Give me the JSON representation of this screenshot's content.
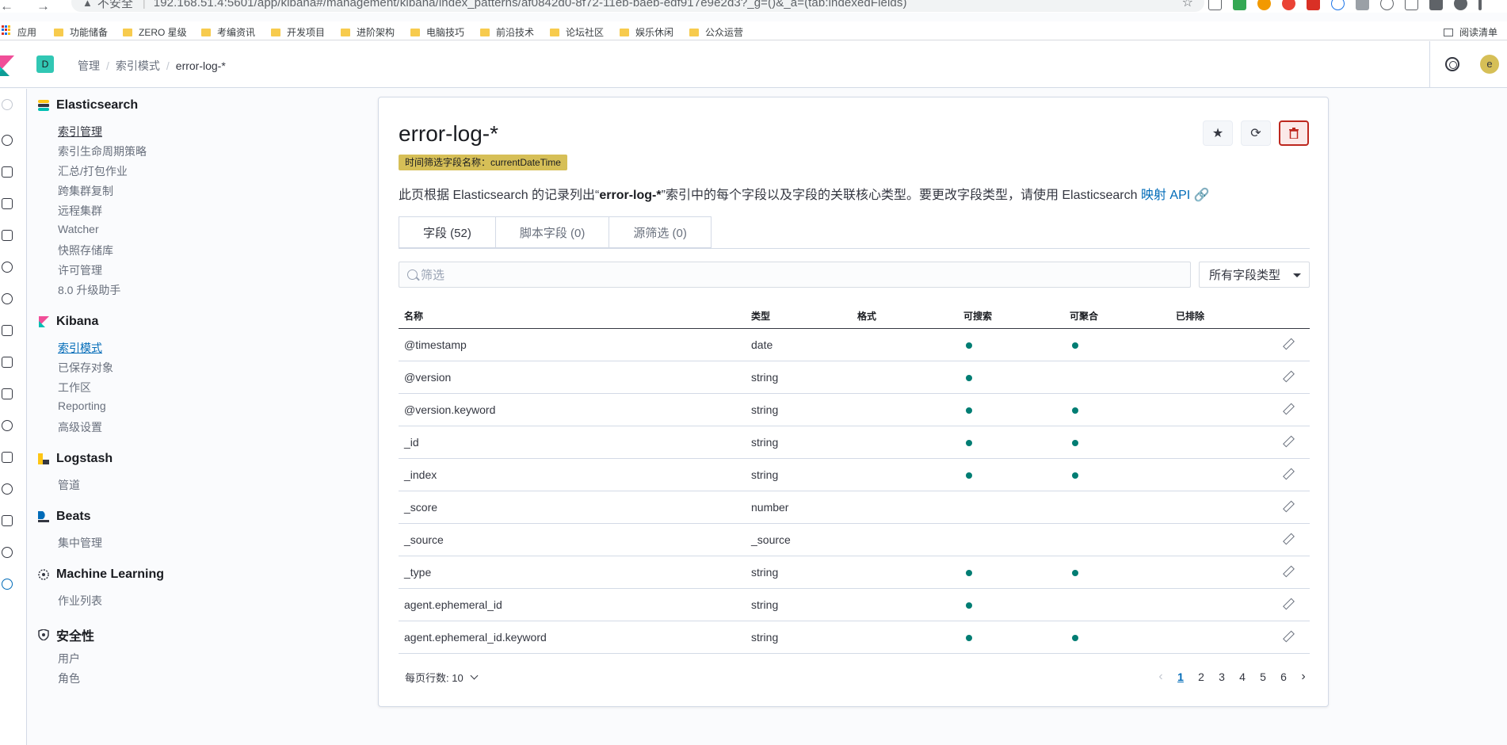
{
  "browser": {
    "insecure_label": "不安全",
    "url": "192.168.51.4:5601/app/kibana#/management/kibana/index_patterns/af0842d0-8f72-11eb-baeb-edf917e9e2d3?_g=()&_a=(tab:indexedFields)",
    "bookmarks": [
      "应用",
      "功能储备",
      "ZERO 星级",
      "考编资讯",
      "开发项目",
      "进阶架构",
      "电脑技巧",
      "前沿技术",
      "论坛社区",
      "娱乐休闲",
      "公众运营"
    ],
    "reading_list": "阅读清单"
  },
  "header": {
    "space_initial": "D",
    "breadcrumbs": [
      "管理",
      "索引模式",
      "error-log-*"
    ],
    "user_initial": "e"
  },
  "side_menu": {
    "elasticsearch": {
      "title": "Elasticsearch",
      "items": [
        "索引管理",
        "索引生命周期策略",
        "汇总/打包作业",
        "跨集群复制",
        "远程集群",
        "Watcher",
        "快照存储库",
        "许可管理",
        "8.0 升级助手"
      ]
    },
    "kibana": {
      "title": "Kibana",
      "items": [
        "索引模式",
        "已保存对象",
        "工作区",
        "Reporting",
        "高级设置"
      ]
    },
    "logstash": {
      "title": "Logstash",
      "items": [
        "管道"
      ]
    },
    "beats": {
      "title": "Beats",
      "items": [
        "集中管理"
      ]
    },
    "ml": {
      "title": "Machine Learning",
      "items": [
        "作业列表"
      ]
    },
    "security": {
      "title": "安全性",
      "items": [
        "用户",
        "角色"
      ]
    }
  },
  "main": {
    "title": "error-log-*",
    "time_field_badge": "时间筛选字段名称：currentDateTime",
    "desc_prefix": "此页根据 Elasticsearch 的记录列出“",
    "desc_pattern": "error-log-*",
    "desc_suffix": "”索引中的每个字段以及字段的关联核心类型。要更改字段类型，请使用 Elasticsearch ",
    "desc_link": "映射 API",
    "tabs": [
      "字段 (52)",
      "脚本字段 (0)",
      "源筛选 (0)"
    ],
    "search_placeholder": "筛选",
    "type_select": "所有字段类型",
    "columns": [
      "名称",
      "类型",
      "格式",
      "可搜索",
      "可聚合",
      "已排除"
    ],
    "rows": [
      {
        "name": "@timestamp",
        "type": "date",
        "format": "",
        "searchable": true,
        "aggregatable": true,
        "excluded": false
      },
      {
        "name": "@version",
        "type": "string",
        "format": "",
        "searchable": true,
        "aggregatable": false,
        "excluded": false
      },
      {
        "name": "@version.keyword",
        "type": "string",
        "format": "",
        "searchable": true,
        "aggregatable": true,
        "excluded": false
      },
      {
        "name": "_id",
        "type": "string",
        "format": "",
        "searchable": true,
        "aggregatable": true,
        "excluded": false
      },
      {
        "name": "_index",
        "type": "string",
        "format": "",
        "searchable": true,
        "aggregatable": true,
        "excluded": false
      },
      {
        "name": "_score",
        "type": "number",
        "format": "",
        "searchable": false,
        "aggregatable": false,
        "excluded": false
      },
      {
        "name": "_source",
        "type": "_source",
        "format": "",
        "searchable": false,
        "aggregatable": false,
        "excluded": false
      },
      {
        "name": "_type",
        "type": "string",
        "format": "",
        "searchable": true,
        "aggregatable": true,
        "excluded": false
      },
      {
        "name": "agent.ephemeral_id",
        "type": "string",
        "format": "",
        "searchable": true,
        "aggregatable": false,
        "excluded": false
      },
      {
        "name": "agent.ephemeral_id.keyword",
        "type": "string",
        "format": "",
        "searchable": true,
        "aggregatable": true,
        "excluded": false
      }
    ],
    "rows_per_page": "每页行数: 10",
    "pages": [
      "1",
      "2",
      "3",
      "4",
      "5",
      "6"
    ],
    "current_page": "1"
  },
  "colors": {
    "accent": "#006bb8",
    "dot": "#017d73",
    "badge": "#d6bf57",
    "danger": "#bd271e",
    "space": "#31c7b4"
  }
}
